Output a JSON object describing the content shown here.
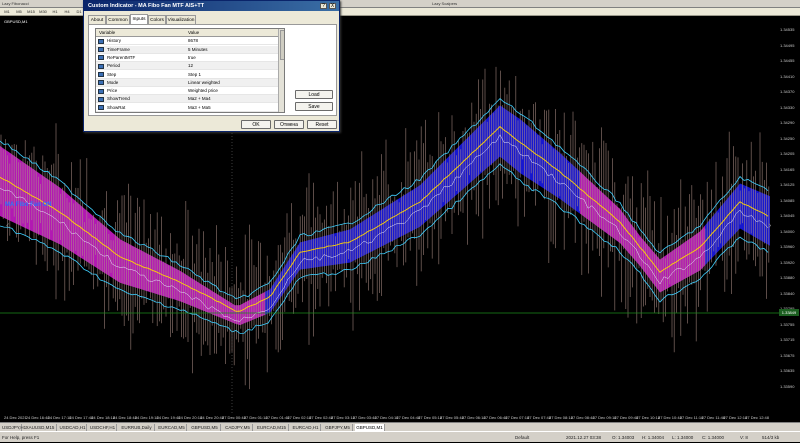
{
  "topbar": {
    "window_title": "Lazy Fibonacci",
    "tool_label": "Lazy Scalpers"
  },
  "timeframes": [
    "M1",
    "M5",
    "M15",
    "M30",
    "H1",
    "H4",
    "D1",
    "W1",
    "MN"
  ],
  "chart": {
    "symbol_title": "GBPUSD,M1",
    "indicator_label": "MA Fibo Fan ON",
    "current_price": "1.33849",
    "y_ticks": [
      "1.34535",
      "1.34495",
      "1.34455",
      "1.34410",
      "1.34370",
      "1.34330",
      "1.34290",
      "1.34250",
      "1.34205",
      "1.34165",
      "1.34125",
      "1.34085",
      "1.34045",
      "1.34000",
      "1.33960",
      "1.33920",
      "1.33880",
      "1.33840",
      "1.33795",
      "1.33755",
      "1.33715",
      "1.33675",
      "1.33635",
      "1.33590"
    ],
    "x_ticks": [
      "24 Dec 2021",
      "24 Dec 16:48",
      "24 Dec 17:18",
      "24 Dec 17:48",
      "24 Dec 18:18",
      "24 Dec 18:48",
      "24 Dec 19:18",
      "24 Dec 19:48",
      "24 Dec 20:18",
      "24 Dec 20:48",
      "27 Dec 00:48",
      "27 Dec 01:18",
      "27 Dec 01:48",
      "27 Dec 02:18",
      "27 Dec 02:48",
      "27 Dec 03:18",
      "27 Dec 03:48",
      "27 Dec 04:18",
      "27 Dec 04:48",
      "27 Dec 05:18",
      "27 Dec 05:48",
      "27 Dec 06:18",
      "27 Dec 06:48",
      "27 Dec 07:18",
      "27 Dec 07:48",
      "27 Dec 08:18",
      "27 Dec 08:48",
      "27 Dec 09:18",
      "27 Dec 09:48",
      "27 Dec 10:18",
      "27 Dec 10:48",
      "27 Dec 11:18",
      "27 Dec 11:48",
      "27 Dec 12:18",
      "27 Dec 12:48"
    ]
  },
  "dialog": {
    "title": "Custom Indicator - MA Fibo Fan MTF AIS+TT",
    "help_btn": "?",
    "close_btn": "X",
    "tabs": [
      "About",
      "Common",
      "Inputs",
      "Colors",
      "Visualization"
    ],
    "active_tab": "Inputs",
    "grid_headers": {
      "variable": "Variable",
      "value": "Value"
    },
    "rows": [
      {
        "variable": "History",
        "value": "8678"
      },
      {
        "variable": "TimeFrame",
        "value": "5 Minutes"
      },
      {
        "variable": "ReParentMTF",
        "value": "true"
      },
      {
        "variable": "Period",
        "value": "12"
      },
      {
        "variable": "Step",
        "value": "Step 1"
      },
      {
        "variable": "Mode",
        "value": "Linear weighted"
      },
      {
        "variable": "Price",
        "value": "Weighted price"
      },
      {
        "variable": "ShowTrend",
        "value": "Ma2 + Ma4"
      },
      {
        "variable": "ShowRat",
        "value": "Ma3 + Ma5"
      }
    ],
    "load_btn": "Load",
    "save_btn": "Save",
    "ok_btn": "OK",
    "cancel_btn": "Отмена",
    "reset_btn": "Reset"
  },
  "tabs": [
    "USDJPY,H1",
    "XAUUSD,M15",
    "USDCAD,H1",
    "USDCHF,H1",
    "EURRUB,Daily",
    "EURCAD,M5",
    "GBPUSD,M5",
    "CADJPY,M5",
    "EURCAD,M15",
    "EURCAD,H1",
    "GBPJPY,M5",
    "GBPUSD,M1"
  ],
  "active_chart_tab": "GBPUSD,M1",
  "status": {
    "help": "For Help, press F1",
    "profile": "Default",
    "datetime": "2021.12.27 03:38",
    "open": "O: 1.34003",
    "high": "H: 1.34004",
    "low": "L: 1.34000",
    "close": "C: 1.34000",
    "volume": "V: 8",
    "traffic": "514/3 kb"
  },
  "colors": {
    "fan_magenta": "#c51cc5",
    "fan_blue": "#1a1ae6",
    "candles": "#b0928a",
    "line_yellow": "#ffd400",
    "line_cyan": "#3fd0ff",
    "current_price_line": "#1b8a1b"
  }
}
